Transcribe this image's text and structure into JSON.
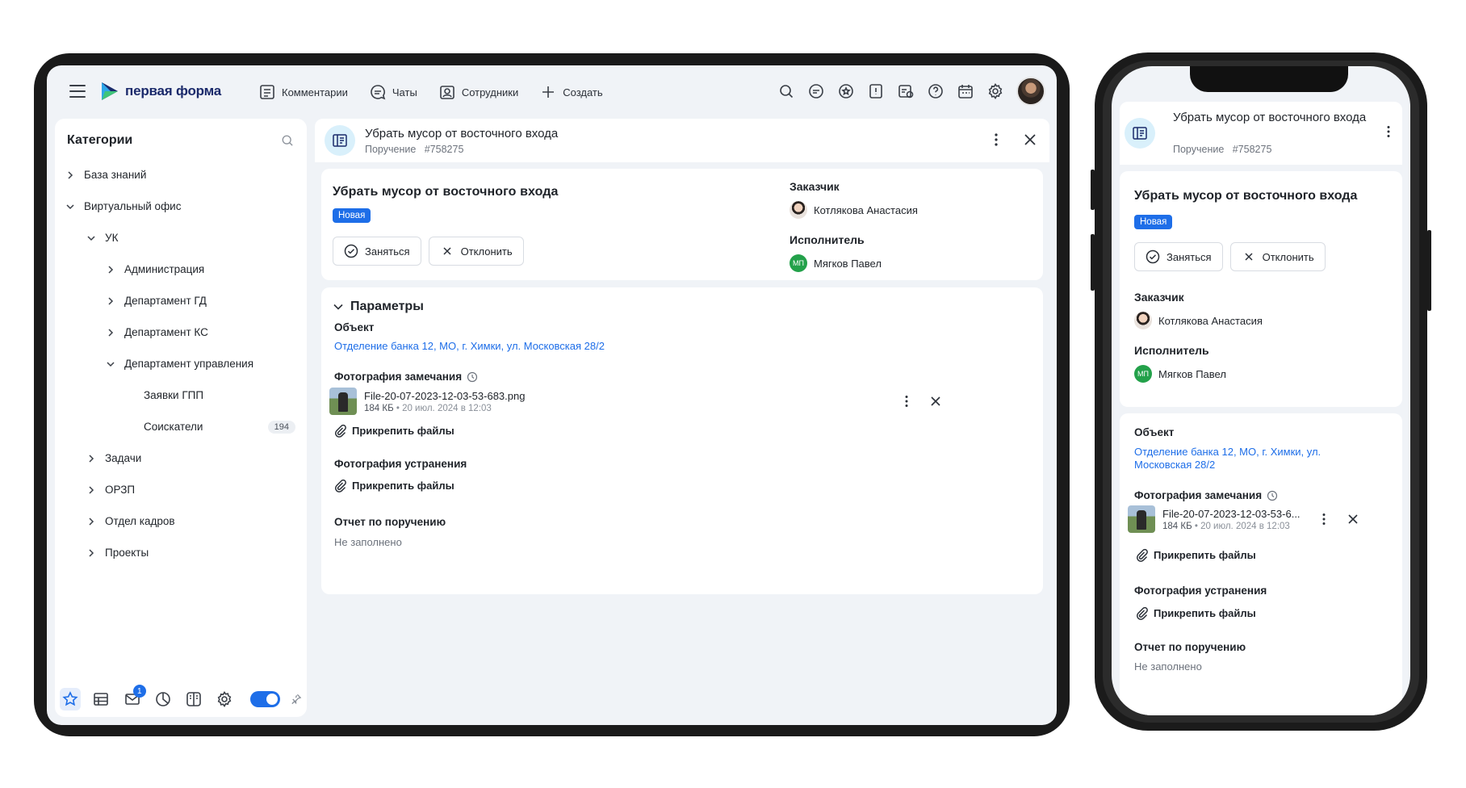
{
  "app": {
    "brand": "первая форма",
    "colors": {
      "accent": "#1e6ee8",
      "bg": "#f0f3f7",
      "green": "#23a14a"
    }
  },
  "topnav": {
    "items": [
      {
        "label": "Комментарии",
        "icon": "comment-doc-icon"
      },
      {
        "label": "Чаты",
        "icon": "chat-icon"
      },
      {
        "label": "Сотрудники",
        "icon": "employees-icon"
      },
      {
        "label": "Создать",
        "icon": "plus-icon"
      }
    ]
  },
  "sidebar": {
    "title": "Категории",
    "tree": [
      {
        "label": "База знаний",
        "level": 0,
        "expanded": false
      },
      {
        "label": "Виртуальный офис",
        "level": 0,
        "expanded": true
      },
      {
        "label": "УК",
        "level": 1,
        "expanded": true
      },
      {
        "label": "Администрация",
        "level": 2,
        "expanded": false
      },
      {
        "label": "Департамент ГД",
        "level": 2,
        "expanded": false
      },
      {
        "label": "Департамент КС",
        "level": 2,
        "expanded": false
      },
      {
        "label": "Департамент управления",
        "level": 2,
        "expanded": true
      },
      {
        "label": "Заявки ГПП",
        "level": 3,
        "leaf": true
      },
      {
        "label": "Соискатели",
        "level": 3,
        "leaf": true,
        "count": "194"
      },
      {
        "label": "Задачи",
        "level": 1,
        "expanded": false
      },
      {
        "label": "ОРЗП",
        "level": 1,
        "expanded": false
      },
      {
        "label": "Отдел кадров",
        "level": 1,
        "expanded": false
      },
      {
        "label": "Проекты",
        "level": 1,
        "expanded": false
      }
    ],
    "mail_badge": "1"
  },
  "task": {
    "title": "Убрать мусор от восточного входа",
    "type": "Поручение",
    "number": "#758275",
    "status": "Новая",
    "take_label": "Заняться",
    "decline_label": "Отклонить",
    "customer_label": "Заказчик",
    "customer_name": "Котлякова Анастасия",
    "executor_label": "Исполнитель",
    "executor_name": "Мягков Павел",
    "executor_initials": "МП"
  },
  "params": {
    "title": "Параметры",
    "object_label": "Объект",
    "object_value": "Отделение банка 12, МО, г. Химки, ул. Московская 28/2",
    "object_value_line1": "Отделение банка 12, МО, г. Химки, ул.",
    "object_value_line2": "Московская 28/2",
    "photo_issue_label": "Фотография замечания",
    "file_name": "File-20-07-2023-12-03-53-683.png",
    "file_name_short": "File-20-07-2023-12-03-53-6...",
    "file_size": "184 КБ",
    "file_date": "20 июл. 2024 в 12:03",
    "attach_label": "Прикрепить файлы",
    "photo_fix_label": "Фотография устранения",
    "report_label": "Отчет по поручению",
    "report_value": "Не заполнено"
  }
}
